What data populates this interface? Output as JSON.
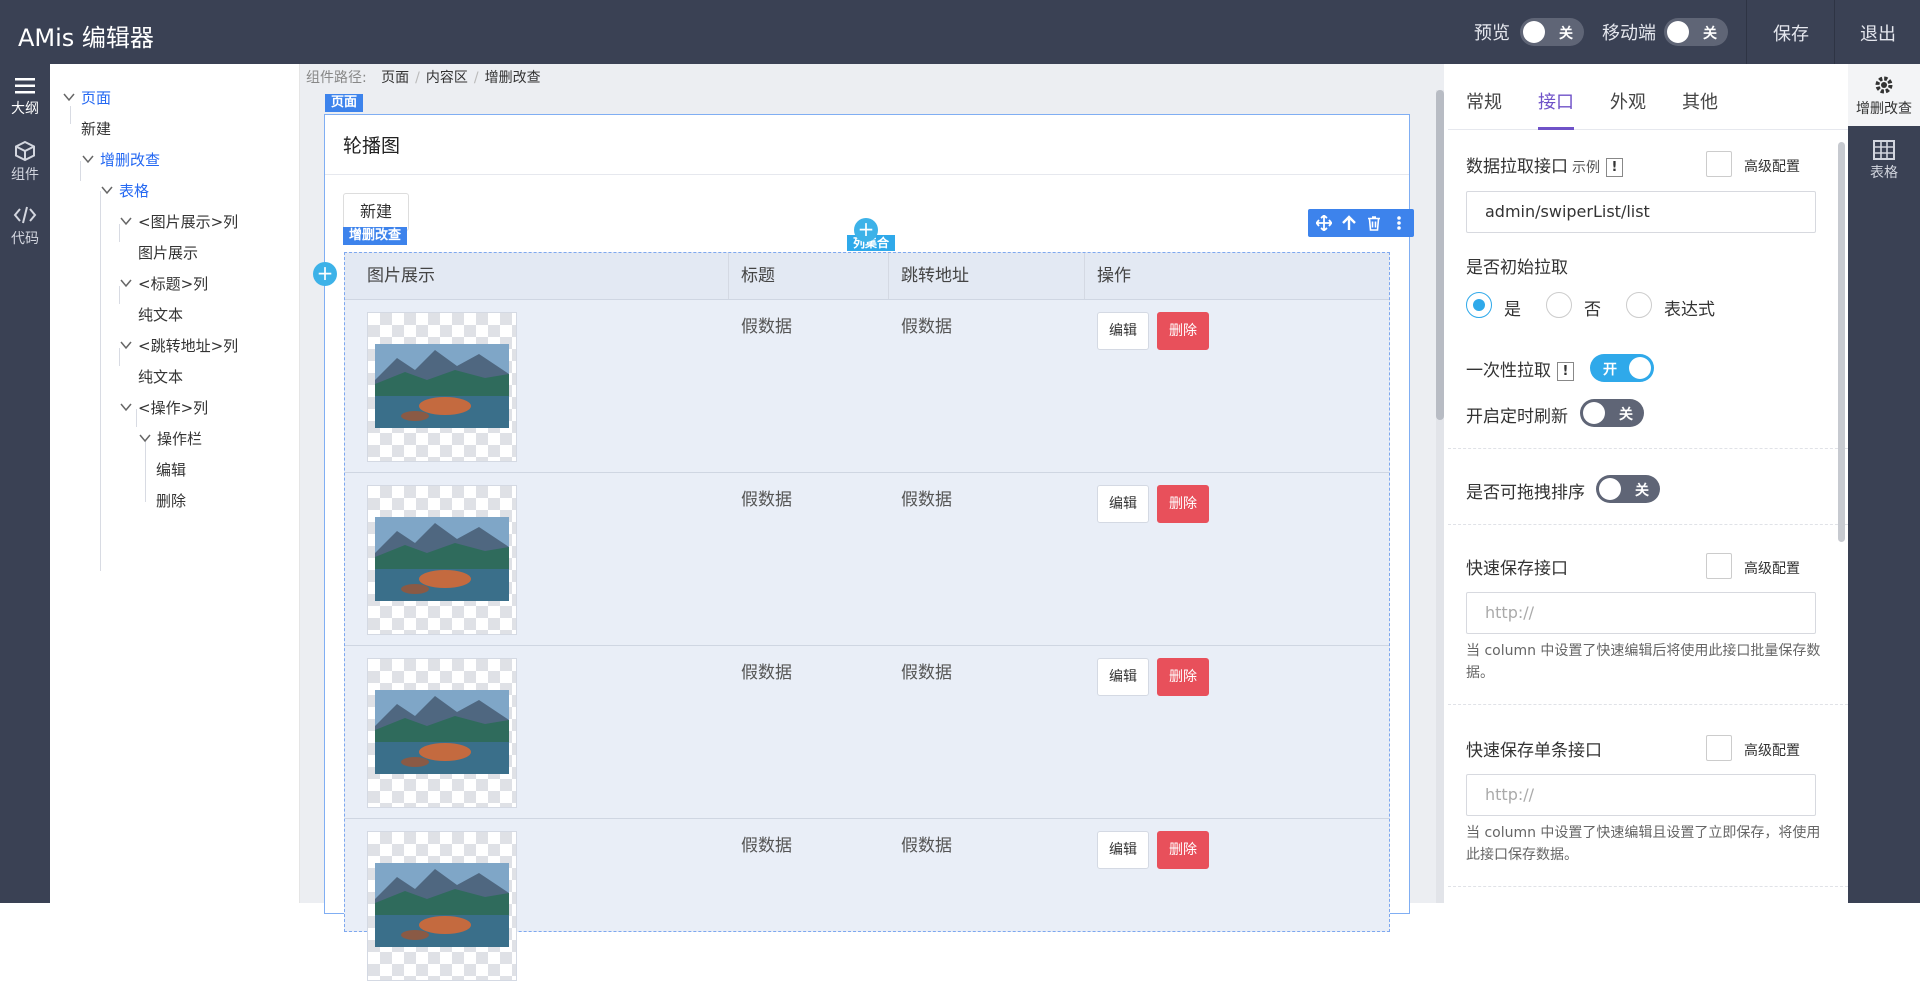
{
  "app": {
    "title": "AMis 编辑器"
  },
  "topbar": {
    "preview_label": "预览",
    "preview_toggle": "关",
    "mobile_label": "移动端",
    "mobile_toggle": "关",
    "save": "保存",
    "exit": "退出"
  },
  "left_rail": [
    {
      "label": "大纲",
      "icon": "menu-icon"
    },
    {
      "label": "组件",
      "icon": "cube-icon"
    },
    {
      "label": "代码",
      "icon": "code-icon"
    }
  ],
  "outline": [
    "页面",
    "新建",
    "增删改查",
    "表格",
    "<图片展示>列",
    "图片展示",
    "<标题>列",
    "纯文本",
    "<跳转地址>列",
    "纯文本",
    "<操作>列",
    "操作栏",
    "编辑",
    "删除"
  ],
  "breadcrumb": {
    "prefix": "组件路径:",
    "items": [
      "页面",
      "内容区",
      "增删改查"
    ]
  },
  "page": {
    "tag": "页面",
    "title": "轮播图",
    "new_button": "新建",
    "crud_tag": "增删改查",
    "col_tag": "列集合",
    "columns": [
      "图片展示",
      "标题",
      "跳转地址",
      "操作"
    ],
    "rows": [
      {
        "title": "假数据",
        "url": "假数据"
      },
      {
        "title": "假数据",
        "url": "假数据"
      },
      {
        "title": "假数据",
        "url": "假数据"
      },
      {
        "title": "假数据",
        "url": "假数据"
      }
    ],
    "edit_label": "编辑",
    "delete_label": "删除"
  },
  "panel": {
    "tabs": [
      "常规",
      "接口",
      "外观",
      "其他"
    ],
    "active_tab": "接口",
    "fetch_api_label": "数据拉取接口",
    "fetch_api_example": "示例",
    "advanced": "高级配置",
    "fetch_api_value": "admin/swiperList/list",
    "init_fetch_label": "是否初始拉取",
    "init_fetch_options": [
      "是",
      "否",
      "表达式"
    ],
    "load_once_label": "一次性拉取",
    "load_once_toggle": "开",
    "interval_label": "开启定时刷新",
    "interval_toggle": "关",
    "draggable_label": "是否可拖拽排序",
    "draggable_toggle": "关",
    "quick_save_label": "快速保存接口",
    "quick_save_placeholder": "http://",
    "quick_save_hint": "当 column 中设置了快速编辑后将使用此接口批量保存数据。",
    "quick_save_item_label": "快速保存单条接口",
    "quick_save_item_placeholder": "http://",
    "quick_save_item_hint": "当 column 中设置了快速编辑且设置了立即保存，将使用此接口保存数据。"
  },
  "right_rail": [
    {
      "label": "增删改查",
      "icon": "gear-icon"
    },
    {
      "label": "表格",
      "icon": "table-icon"
    }
  ]
}
